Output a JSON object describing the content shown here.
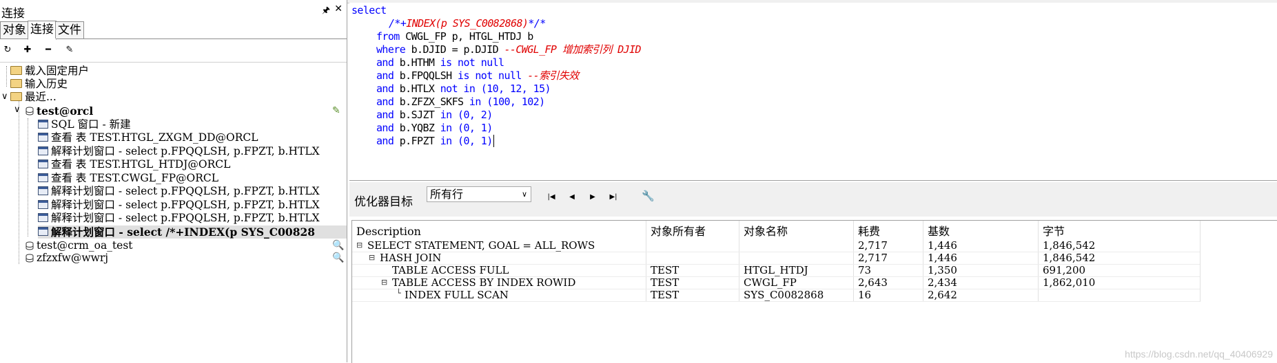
{
  "left_panel": {
    "title": "连接",
    "pin_icon": "pin-icon",
    "close_icon": "close-icon",
    "tabs": [
      {
        "label": "对象",
        "active": false
      },
      {
        "label": "连接",
        "active": true
      },
      {
        "label": "文件",
        "active": false
      }
    ],
    "toolbar_icons": [
      "refresh-icon",
      "add-icon",
      "remove-icon",
      "properties-icon"
    ],
    "tree": {
      "folders": [
        "载入固定用户",
        "输入历史",
        "最近..."
      ],
      "connection": "test@orcl",
      "windows": [
        "SQL 窗口 - 新建",
        "查看 表 TEST.HTGL_ZXGM_DD@ORCL",
        "解释计划窗口 - select p.FPQQLSH, p.FPZT, b.HTLX",
        "查看 表 TEST.HTGL_HTDJ@ORCL",
        "查看 表 TEST.CWGL_FP@ORCL",
        "解释计划窗口 - select p.FPQQLSH, p.FPZT, b.HTLX",
        "解释计划窗口 - select p.FPQQLSH, p.FPZT, b.HTLX",
        "解释计划窗口 - select p.FPQQLSH, p.FPZT, b.HTLX",
        "解释计划窗口 - select /*+INDEX(p SYS_C00828"
      ],
      "other_connections": [
        "test@crm_oa_test",
        "zfzxfw@wwrj"
      ]
    }
  },
  "editor": {
    "lines": [
      {
        "indent": 0,
        "parts": [
          {
            "t": "select",
            "c": "kw"
          }
        ]
      },
      {
        "indent": 2,
        "parts": [
          {
            "t": "/*+",
            "c": "hintmark"
          },
          {
            "t": "INDEX(p SYS_C0082868)",
            "c": "hint"
          },
          {
            "t": "*/*",
            "c": "hintmark"
          }
        ]
      },
      {
        "indent": 1,
        "parts": [
          {
            "t": "from",
            "c": "kw"
          },
          {
            "t": " CWGL_FP p, HTGL_HTDJ b",
            "c": "plain"
          }
        ]
      },
      {
        "indent": 1,
        "parts": [
          {
            "t": "where",
            "c": "kw"
          },
          {
            "t": " b.DJID = p.DJID ",
            "c": "plain"
          },
          {
            "t": "--CWGL_FP 增加索引列 DJID",
            "c": "cm"
          }
        ]
      },
      {
        "indent": 1,
        "parts": [
          {
            "t": "and",
            "c": "kw"
          },
          {
            "t": " b.HTHM ",
            "c": "plain"
          },
          {
            "t": "is not null",
            "c": "kw"
          }
        ]
      },
      {
        "indent": 1,
        "parts": [
          {
            "t": "and",
            "c": "kw"
          },
          {
            "t": " b.FPQQLSH ",
            "c": "plain"
          },
          {
            "t": "is not null",
            "c": "kw"
          },
          {
            "t": " ",
            "c": "plain"
          },
          {
            "t": "--索引失效",
            "c": "cm"
          }
        ]
      },
      {
        "indent": 1,
        "parts": [
          {
            "t": "and",
            "c": "kw"
          },
          {
            "t": " b.HTLX ",
            "c": "plain"
          },
          {
            "t": "not in",
            "c": "kw"
          },
          {
            "t": " (10, 12, 15)",
            "c": "num"
          }
        ]
      },
      {
        "indent": 1,
        "parts": [
          {
            "t": "and",
            "c": "kw"
          },
          {
            "t": " b.ZFZX_SKFS ",
            "c": "plain"
          },
          {
            "t": "in",
            "c": "kw"
          },
          {
            "t": " (100, 102)",
            "c": "num"
          }
        ]
      },
      {
        "indent": 1,
        "parts": [
          {
            "t": "and",
            "c": "kw"
          },
          {
            "t": " b.SJZT ",
            "c": "plain"
          },
          {
            "t": "in",
            "c": "kw"
          },
          {
            "t": " (0, 2)",
            "c": "num"
          }
        ]
      },
      {
        "indent": 1,
        "parts": [
          {
            "t": "and",
            "c": "kw"
          },
          {
            "t": " b.YQBZ ",
            "c": "plain"
          },
          {
            "t": "in",
            "c": "kw"
          },
          {
            "t": " (0, 1)",
            "c": "num"
          }
        ]
      },
      {
        "indent": 1,
        "parts": [
          {
            "t": "and",
            "c": "kw"
          },
          {
            "t": " p.FPZT ",
            "c": "plain"
          },
          {
            "t": "in",
            "c": "kw"
          },
          {
            "t": " (0, 1)",
            "c": "num"
          }
        ]
      }
    ]
  },
  "plan_toolbar": {
    "goal_label": "优化器目标",
    "goal_value": "所有行",
    "nav_icons": [
      "first-icon",
      "prev-icon",
      "next-icon",
      "last-icon"
    ],
    "settings_icon": "wrench-icon"
  },
  "plan_grid": {
    "columns": [
      "Description",
      "对象所有者",
      "对象名称",
      "耗费",
      "基数",
      "字节"
    ],
    "rows": [
      {
        "level": 0,
        "expander": "minus",
        "desc": "SELECT STATEMENT, GOAL = ALL_ROWS",
        "owner": "",
        "name": "",
        "cost": "2,717",
        "card": "1,446",
        "bytes": "1,846,542"
      },
      {
        "level": 1,
        "expander": "minus",
        "desc": "HASH JOIN",
        "owner": "",
        "name": "",
        "cost": "2,717",
        "card": "1,446",
        "bytes": "1,846,542"
      },
      {
        "level": 2,
        "expander": "none",
        "desc": "TABLE ACCESS FULL",
        "owner": "TEST",
        "name": "HTGL_HTDJ",
        "cost": "73",
        "card": "1,350",
        "bytes": "691,200"
      },
      {
        "level": 2,
        "expander": "minus",
        "desc": "TABLE ACCESS BY INDEX ROWID",
        "owner": "TEST",
        "name": "CWGL_FP",
        "cost": "2,643",
        "card": "2,434",
        "bytes": "1,862,010"
      },
      {
        "level": 3,
        "expander": "leaf",
        "desc": "INDEX FULL SCAN",
        "owner": "TEST",
        "name": "SYS_C0082868",
        "cost": "16",
        "card": "2,642",
        "bytes": ""
      }
    ]
  },
  "watermark": "https://blog.csdn.net/qq_40406929"
}
